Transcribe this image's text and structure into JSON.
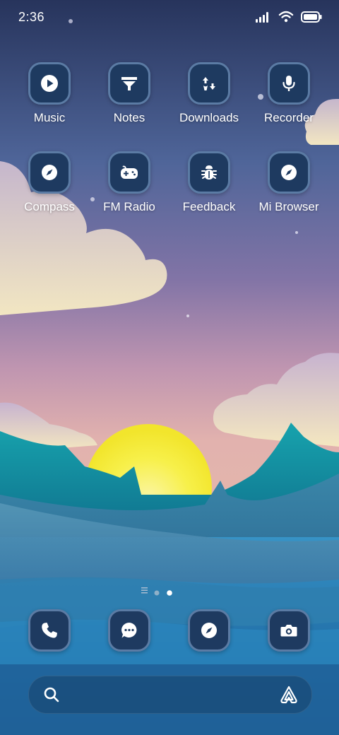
{
  "status_bar": {
    "time": "2:36",
    "icons": [
      "signal-icon",
      "wifi-icon",
      "battery-icon"
    ]
  },
  "home": {
    "rows": [
      [
        {
          "label": "Music",
          "icon": "play-icon"
        },
        {
          "label": "Notes",
          "icon": "notes-icon"
        },
        {
          "label": "Downloads",
          "icon": "downloads-icon"
        },
        {
          "label": "Recorder",
          "icon": "microphone-icon"
        }
      ],
      [
        {
          "label": "Compass",
          "icon": "compass-icon"
        },
        {
          "label": "FM Radio",
          "icon": "gamepad-icon"
        },
        {
          "label": "Feedback",
          "icon": "bug-icon"
        },
        {
          "label": "Mi Browser",
          "icon": "compass-icon"
        }
      ]
    ]
  },
  "page_indicator": {
    "pages": 3,
    "current": 3
  },
  "dock": [
    {
      "icon": "phone-icon"
    },
    {
      "icon": "chat-icon"
    },
    {
      "icon": "compass-icon"
    },
    {
      "icon": "camera-icon"
    }
  ],
  "search": {
    "placeholder": "",
    "value": ""
  },
  "colors": {
    "icon_tile": "#1e3a60",
    "icon_border": "#5b7ba4",
    "sky_top": "#2a3b66",
    "sky_mid": "#8a78a8",
    "sky_low": "#d9a3b0",
    "sun": "#f5ee3c",
    "hills": "#1a8fa0",
    "water": "#2f8bbd"
  }
}
